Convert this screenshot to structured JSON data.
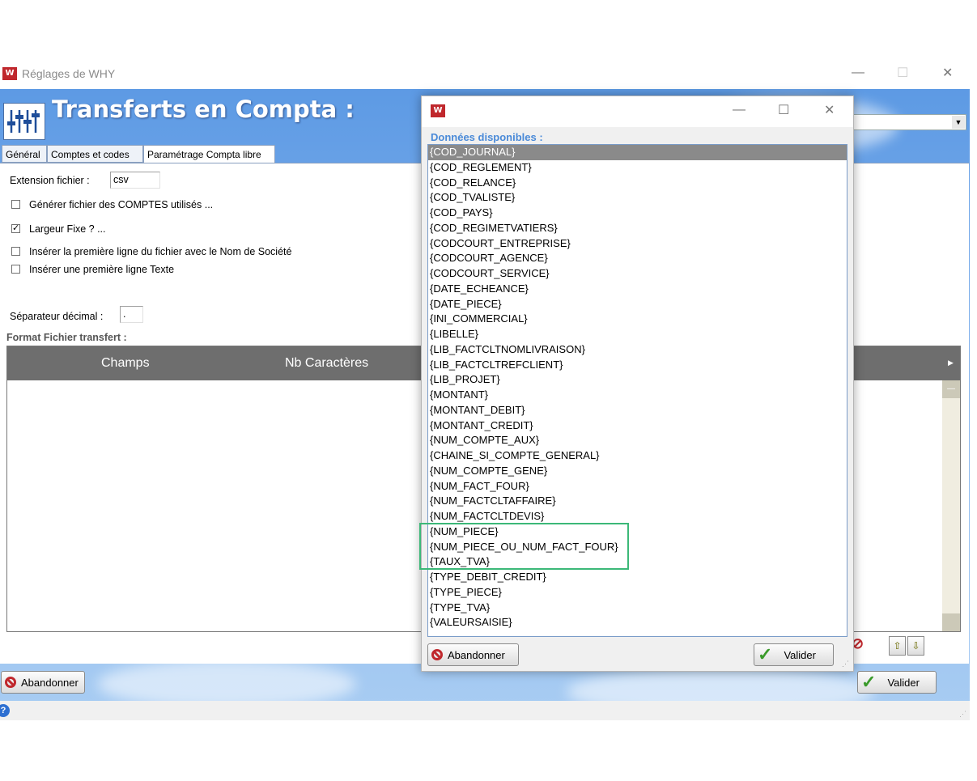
{
  "window": {
    "title": "Réglages de WHY",
    "logo_text": "W",
    "minimize": "—",
    "maximize": "☐",
    "close": "✕"
  },
  "header": {
    "title": "Transferts en Compta :"
  },
  "tabs": [
    {
      "label": "Général"
    },
    {
      "label": "Comptes et codes"
    },
    {
      "label": "Paramétrage Compta libre",
      "active": true
    }
  ],
  "form": {
    "extension_label": "Extension fichier :",
    "extension_value": "csv",
    "checkboxes": [
      {
        "label": "Générer fichier des COMPTES utilisés ...",
        "checked": false
      },
      {
        "label": "Largeur Fixe ? ...",
        "checked": true
      },
      {
        "label": "Insérer la première ligne du fichier avec le Nom de Société",
        "checked": false
      },
      {
        "label": "Insérer une première ligne Texte",
        "checked": false
      }
    ],
    "decimal_label": "Séparateur décimal :",
    "decimal_value": ".",
    "format_label": "Format Fichier transfert :"
  },
  "grid": {
    "columns": [
      "Champs",
      "Nb Caractères"
    ]
  },
  "footer": {
    "cancel_label": "Abandonner",
    "validate_label": "Valider",
    "help_icon": "?"
  },
  "dialog": {
    "logo_text": "W",
    "minimize": "—",
    "maximize": "☐",
    "close": "✕",
    "caption": "Données disponibles :",
    "items": [
      "{COD_JOURNAL}",
      "{COD_REGLEMENT}",
      "{COD_RELANCE}",
      "{COD_TVALISTE}",
      "{COD_PAYS}",
      "{COD_REGIMETVATIERS}",
      "{CODCOURT_ENTREPRISE}",
      "{CODCOURT_AGENCE}",
      "{CODCOURT_SERVICE}",
      "{DATE_ECHEANCE}",
      "{DATE_PIECE}",
      "{INI_COMMERCIAL}",
      "{LIBELLE}",
      "{LIB_FACTCLTNOMLIVRAISON}",
      "{LIB_FACTCLTREFCLIENT}",
      "{LIB_PROJET}",
      "{MONTANT}",
      "{MONTANT_DEBIT}",
      "{MONTANT_CREDIT}",
      "{NUM_COMPTE_AUX}",
      "{CHAINE_SI_COMPTE_GENERAL}",
      "{NUM_COMPTE_GENE}",
      "{NUM_FACT_FOUR}",
      "{NUM_FACTCLTAFFAIRE}",
      "{NUM_FACTCLTDEVIS}",
      "{NUM_PIECE}",
      "{NUM_PIECE_OU_NUM_FACT_FOUR}",
      "{TAUX_TVA}",
      "{TYPE_DEBIT_CREDIT}",
      "{TYPE_PIECE}",
      "{TYPE_TVA}",
      "{VALEURSAISIE}"
    ],
    "selected_index": 0,
    "cancel_label": "Abandonner",
    "validate_label": "Valider"
  },
  "colors": {
    "highlight_box": "#3cb878",
    "brand_red": "#c0282d",
    "caption_blue": "#4a8ad8"
  }
}
